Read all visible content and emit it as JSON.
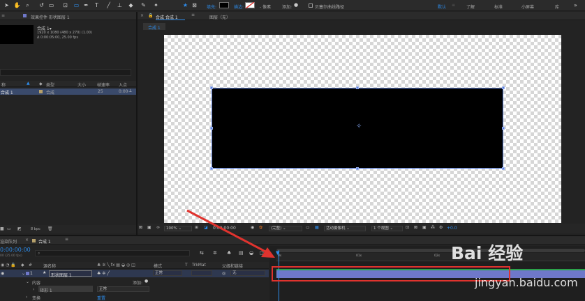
{
  "toolbar": {
    "fill_label": "填充:",
    "stroke_label": "描边:",
    "stroke_px": "- 像素",
    "add_label": "添加:",
    "bezier_label": "贝塞尔曲线路径",
    "workspaces": [
      "默认",
      "了解",
      "标准",
      "小屏幕",
      "库"
    ]
  },
  "project_panel": {
    "header": "效果控件 形状图层 1",
    "comp_name": "合成 1▾",
    "comp_size": "1920 x 1080 (480 x 270) (1.00)",
    "comp_duration": "Δ 0:00:05:00, 25.00 fps",
    "columns": [
      "称",
      "类型",
      "大小",
      "帧速率",
      "入点"
    ],
    "item_name": "合成 1",
    "item_type": "合成",
    "item_fps": "25",
    "item_in": "0:00",
    "bpc": "8 bpc"
  },
  "viewer": {
    "tab_label": "合成 合成 1",
    "layer_label": "图层（无）",
    "subtab": "合成 1",
    "zoom": "100%",
    "timecode": "0:00:00:00",
    "resolution": "(完整)",
    "camera": "活动摄像机",
    "views": "1 个视图",
    "exposure": "+0.0"
  },
  "timeline": {
    "render_queue": "渲染队列",
    "comp_tab": "合成 1",
    "timecode": "0:00:00:00",
    "fps_note": "00 (25.00 fps)",
    "col_num": "#",
    "col_source": "源名称",
    "col_mode": "模式",
    "col_t": "T",
    "col_trkmat": "TrkMat",
    "col_parent": "父级和链接",
    "layer_index": "1",
    "layer_name": "形状图层 1",
    "layer_mode": "正常",
    "layer_parent": "无",
    "content_label": "内容",
    "add_label": "添加:",
    "shape_label": "矩形 1",
    "shape_mode": "正常",
    "transform_label": "变换",
    "reset_label": "重置",
    "ruler_ticks": [
      "0s",
      "01s",
      "02s"
    ]
  },
  "watermark": {
    "text": "Bai 经验",
    "url": "jingyan.baidu.com"
  },
  "colors": {
    "accent": "#2d8ceb",
    "layer_bar": "#6f78c9",
    "highlight_box": "#e0332e",
    "arrow": "#e0332e"
  }
}
